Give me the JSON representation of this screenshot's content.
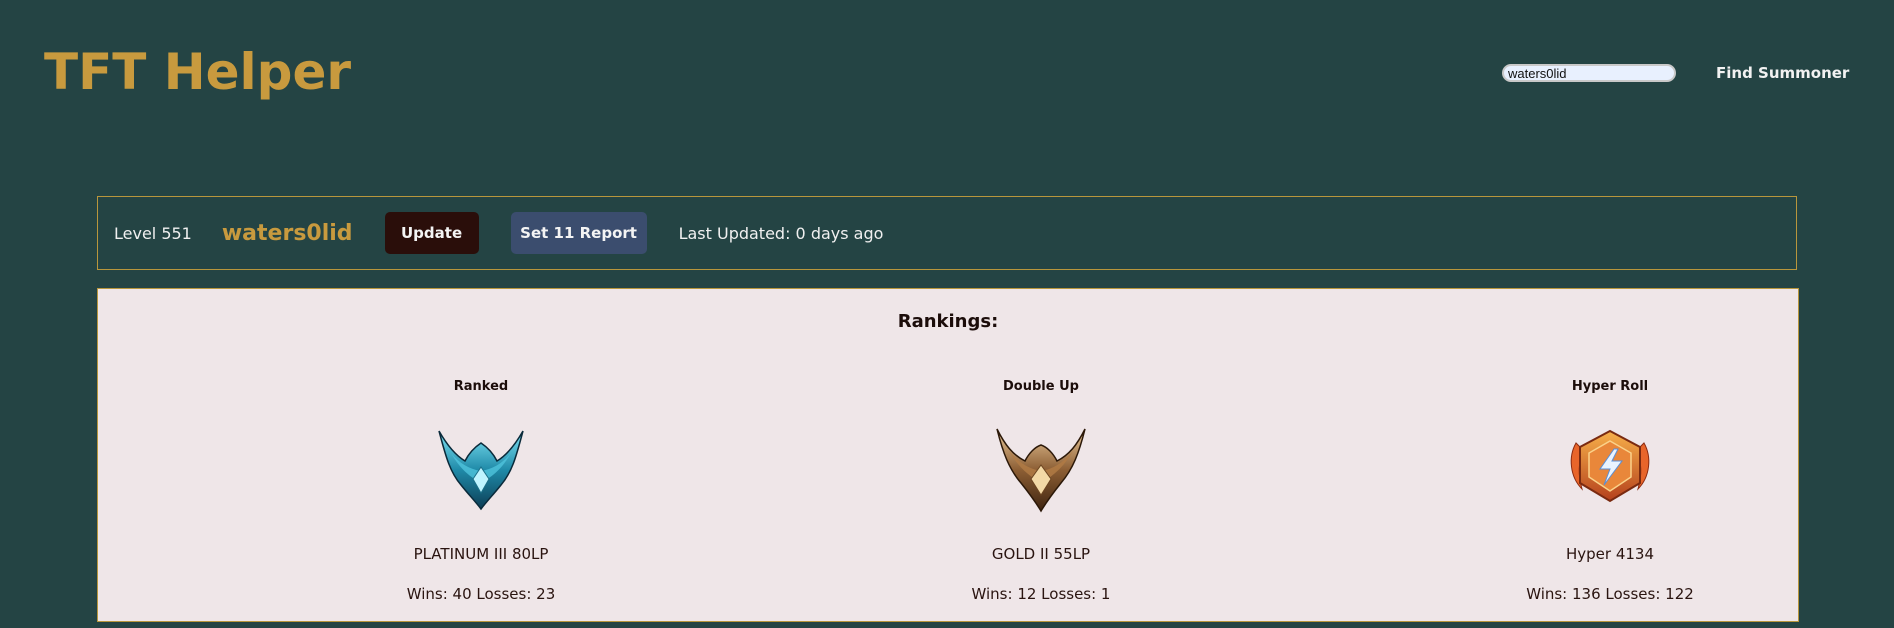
{
  "header": {
    "title": "TFT Helper",
    "search_value": "waters0lid",
    "find_label": "Find Summoner"
  },
  "profile": {
    "level": "Level 551",
    "summoner_name": "waters0lid",
    "update_label": "Update",
    "report_label": "Set 11 Report",
    "last_updated": "Last Updated: 0 days ago"
  },
  "rankings": {
    "title": "Rankings:",
    "queues": [
      {
        "name": "Ranked",
        "emblem": "platinum-emblem-icon",
        "rank": "PLATINUM III 80LP",
        "record": "Wins: 40 Losses: 23"
      },
      {
        "name": "Double Up",
        "emblem": "gold-emblem-icon",
        "rank": "GOLD II 55LP",
        "record": "Wins: 12 Losses: 1"
      },
      {
        "name": "Hyper Roll",
        "emblem": "hyper-roll-emblem-icon",
        "rank": "Hyper 4134",
        "record": "Wins: 136 Losses: 122"
      }
    ]
  },
  "colors": {
    "background": "#244444",
    "accent_gold": "#c89a3e",
    "panel": "#efe6e8",
    "update_button": "#2a0e0a",
    "report_button": "#3b4d6e"
  }
}
